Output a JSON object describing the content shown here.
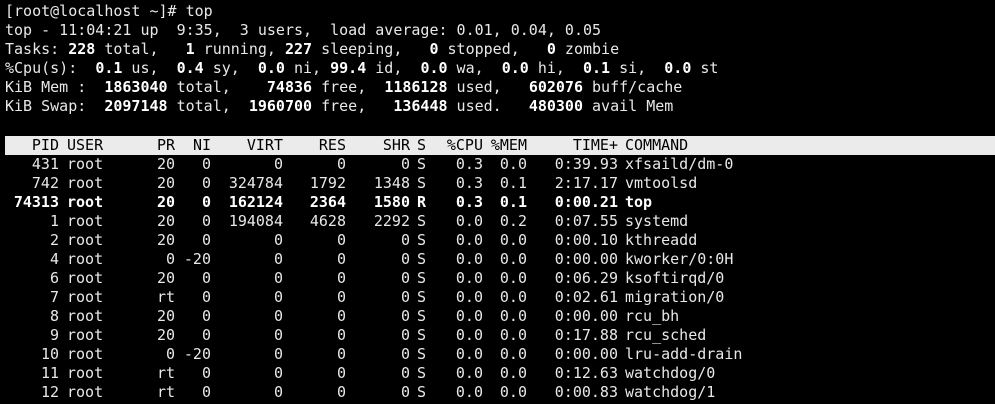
{
  "prompt": {
    "user_host": "[root@localhost ~]# ",
    "command": "top"
  },
  "summary": {
    "line1": "top - 11:04:21 up  9:35,  3 users,  load average: 0.01, 0.04, 0.05",
    "tasks": {
      "label": "Tasks: ",
      "total": "228",
      "total_label": " total,   ",
      "running": "1",
      "running_label": " running, ",
      "sleeping": "227",
      "sleeping_label": " sleeping,   ",
      "stopped": "0",
      "stopped_label": " stopped,   ",
      "zombie": "0",
      "zombie_label": " zombie"
    },
    "cpu": {
      "label": "%Cpu(s):  ",
      "us": "0.1",
      "us_label": " us,  ",
      "sy": "0.4",
      "sy_label": " sy,  ",
      "ni": "0.0",
      "ni_label": " ni, ",
      "id": "99.4",
      "id_label": " id,  ",
      "wa": "0.0",
      "wa_label": " wa,  ",
      "hi": "0.0",
      "hi_label": " hi,  ",
      "si": "0.1",
      "si_label": " si,  ",
      "st": "0.0",
      "st_label": " st"
    },
    "mem": {
      "label": "KiB Mem :  ",
      "total": "1863040",
      "total_label": " total,    ",
      "free": "74836",
      "free_label": " free,  ",
      "used": "1186128",
      "used_label": " used,   ",
      "buff": "602076",
      "buff_label": " buff/cache"
    },
    "swap": {
      "label": "KiB Swap:  ",
      "total": "2097148",
      "total_label": " total,  ",
      "free": "1960700",
      "free_label": " free,   ",
      "used": "136448",
      "used_label": " used.   ",
      "avail": "480300",
      "avail_label": " avail Mem"
    }
  },
  "columns": [
    "PID",
    "USER",
    "PR",
    "NI",
    "VIRT",
    "RES",
    "SHR",
    "S",
    "%CPU",
    "%MEM",
    "TIME+",
    "COMMAND"
  ],
  "processes": [
    {
      "pid": "431",
      "user": "root",
      "pr": "20",
      "ni": "0",
      "virt": "0",
      "res": "0",
      "shr": "0",
      "s": "S",
      "cpu": "0.3",
      "mem": "0.0",
      "time": "0:39.93",
      "command": "xfsaild/dm-0"
    },
    {
      "pid": "742",
      "user": "root",
      "pr": "20",
      "ni": "0",
      "virt": "324784",
      "res": "1792",
      "shr": "1348",
      "s": "S",
      "cpu": "0.3",
      "mem": "0.1",
      "time": "2:17.17",
      "command": "vmtoolsd"
    },
    {
      "pid": "74313",
      "user": "root",
      "pr": "20",
      "ni": "0",
      "virt": "162124",
      "res": "2364",
      "shr": "1580",
      "s": "R",
      "cpu": "0.3",
      "mem": "0.1",
      "time": "0:00.21",
      "command": "top"
    },
    {
      "pid": "1",
      "user": "root",
      "pr": "20",
      "ni": "0",
      "virt": "194084",
      "res": "4628",
      "shr": "2292",
      "s": "S",
      "cpu": "0.0",
      "mem": "0.2",
      "time": "0:07.55",
      "command": "systemd"
    },
    {
      "pid": "2",
      "user": "root",
      "pr": "20",
      "ni": "0",
      "virt": "0",
      "res": "0",
      "shr": "0",
      "s": "S",
      "cpu": "0.0",
      "mem": "0.0",
      "time": "0:00.10",
      "command": "kthreadd"
    },
    {
      "pid": "4",
      "user": "root",
      "pr": "0",
      "ni": "-20",
      "virt": "0",
      "res": "0",
      "shr": "0",
      "s": "S",
      "cpu": "0.0",
      "mem": "0.0",
      "time": "0:00.00",
      "command": "kworker/0:0H"
    },
    {
      "pid": "6",
      "user": "root",
      "pr": "20",
      "ni": "0",
      "virt": "0",
      "res": "0",
      "shr": "0",
      "s": "S",
      "cpu": "0.0",
      "mem": "0.0",
      "time": "0:06.29",
      "command": "ksoftirqd/0"
    },
    {
      "pid": "7",
      "user": "root",
      "pr": "rt",
      "ni": "0",
      "virt": "0",
      "res": "0",
      "shr": "0",
      "s": "S",
      "cpu": "0.0",
      "mem": "0.0",
      "time": "0:02.61",
      "command": "migration/0"
    },
    {
      "pid": "8",
      "user": "root",
      "pr": "20",
      "ni": "0",
      "virt": "0",
      "res": "0",
      "shr": "0",
      "s": "S",
      "cpu": "0.0",
      "mem": "0.0",
      "time": "0:00.00",
      "command": "rcu_bh"
    },
    {
      "pid": "9",
      "user": "root",
      "pr": "20",
      "ni": "0",
      "virt": "0",
      "res": "0",
      "shr": "0",
      "s": "S",
      "cpu": "0.0",
      "mem": "0.0",
      "time": "0:17.88",
      "command": "rcu_sched"
    },
    {
      "pid": "10",
      "user": "root",
      "pr": "0",
      "ni": "-20",
      "virt": "0",
      "res": "0",
      "shr": "0",
      "s": "S",
      "cpu": "0.0",
      "mem": "0.0",
      "time": "0:00.00",
      "command": "lru-add-drain"
    },
    {
      "pid": "11",
      "user": "root",
      "pr": "rt",
      "ni": "0",
      "virt": "0",
      "res": "0",
      "shr": "0",
      "s": "S",
      "cpu": "0.0",
      "mem": "0.0",
      "time": "0:12.63",
      "command": "watchdog/0"
    },
    {
      "pid": "12",
      "user": "root",
      "pr": "rt",
      "ni": "0",
      "virt": "0",
      "res": "0",
      "shr": "0",
      "s": "S",
      "cpu": "0.0",
      "mem": "0.0",
      "time": "0:00.83",
      "command": "watchdog/1"
    }
  ],
  "highlight_pid": "74313",
  "colors": {
    "background": "#000000",
    "foreground": "#e8e8e8",
    "header_bar": "#ebebeb",
    "header_text": "#000000"
  }
}
